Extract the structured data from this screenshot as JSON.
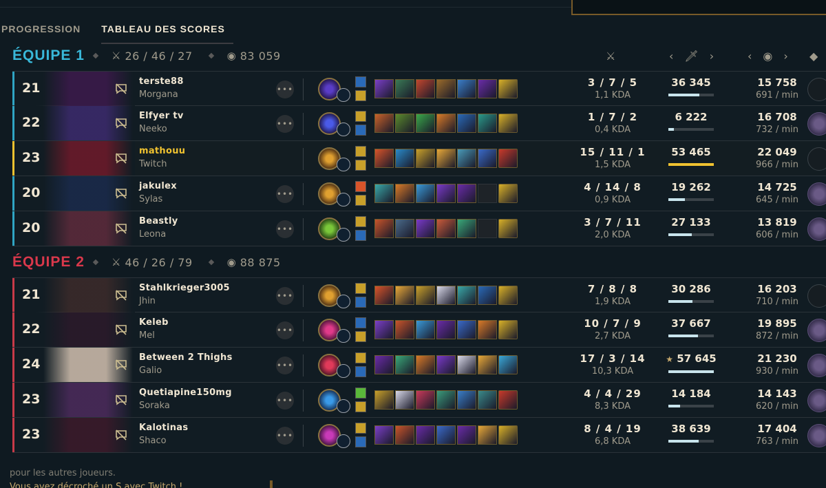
{
  "tabs": {
    "progression": "PROGRESSION",
    "scoreboard": "TABLEAU DES SCORES"
  },
  "team1": {
    "name": "ÉQUIPE 1",
    "kda": "26 / 46 / 27",
    "gold": "83 059"
  },
  "team2": {
    "name": "ÉQUIPE 2",
    "kda": "46 / 26 / 79",
    "gold": "88 875"
  },
  "team1_players": [
    {
      "level": "21",
      "name": "terste88",
      "champion": "Morgana",
      "kda": "3 / 7 / 5",
      "kda_ratio": "1,1 KDA",
      "damage": "36 345",
      "damage_pct": 0.68,
      "gold": "15 758",
      "gold_rate": "691 / min"
    },
    {
      "level": "22",
      "name": "Elfyer tv",
      "champion": "Neeko",
      "kda": "1 / 7 / 2",
      "kda_ratio": "0,4 KDA",
      "damage": "6 222",
      "damage_pct": 0.12,
      "gold": "16 708",
      "gold_rate": "732 / min"
    },
    {
      "level": "23",
      "name": "mathouu",
      "champion": "Twitch",
      "kda": "15 / 11 / 1",
      "kda_ratio": "1,5 KDA",
      "damage": "53 465",
      "damage_pct": 1.0,
      "gold": "22 049",
      "gold_rate": "966 / min"
    },
    {
      "level": "20",
      "name": "jakulex",
      "champion": "Sylas",
      "kda": "4 / 14 / 8",
      "kda_ratio": "0,9 KDA",
      "damage": "19 262",
      "damage_pct": 0.36,
      "gold": "14 725",
      "gold_rate": "645 / min"
    },
    {
      "level": "20",
      "name": "Beastly",
      "champion": "Leona",
      "kda": "3 / 7 / 11",
      "kda_ratio": "2,0 KDA",
      "damage": "27 133",
      "damage_pct": 0.51,
      "gold": "13 819",
      "gold_rate": "606 / min"
    }
  ],
  "team2_players": [
    {
      "level": "21",
      "name": "Stahlkrieger3005",
      "champion": "Jhin",
      "kda": "7 / 8 / 8",
      "kda_ratio": "1,9 KDA",
      "damage": "30 286",
      "damage_pct": 0.53,
      "gold": "16 203",
      "gold_rate": "710 / min"
    },
    {
      "level": "22",
      "name": "Keleb",
      "champion": "Mel",
      "kda": "10 / 7 / 9",
      "kda_ratio": "2,7 KDA",
      "damage": "37 667",
      "damage_pct": 0.65,
      "gold": "19 895",
      "gold_rate": "872 / min"
    },
    {
      "level": "24",
      "name": "Between 2 Thighs",
      "champion": "Galio",
      "kda": "17 / 3 / 14",
      "kda_ratio": "10,3 KDA",
      "damage": "57 645",
      "damage_pct": 1.0,
      "gold": "21 230",
      "gold_rate": "930 / min"
    },
    {
      "level": "23",
      "name": "Quetiapine150mg",
      "champion": "Soraka",
      "kda": "4 / 4 / 29",
      "kda_ratio": "8,3 KDA",
      "damage": "14 184",
      "damage_pct": 0.25,
      "gold": "14 143",
      "gold_rate": "620 / min"
    },
    {
      "level": "23",
      "name": "Kalotinas",
      "champion": "Shaco",
      "kda": "8 / 4 / 19",
      "kda_ratio": "6,8 KDA",
      "damage": "38 639",
      "damage_pct": 0.67,
      "gold": "17 404",
      "gold_rate": "763 / min"
    }
  ],
  "more_glyph": "•••",
  "star_glyph": "★",
  "footer": {
    "line1": "pour les autres joueurs.",
    "line2": "Vous avez décroché un S avec Twitch !"
  }
}
